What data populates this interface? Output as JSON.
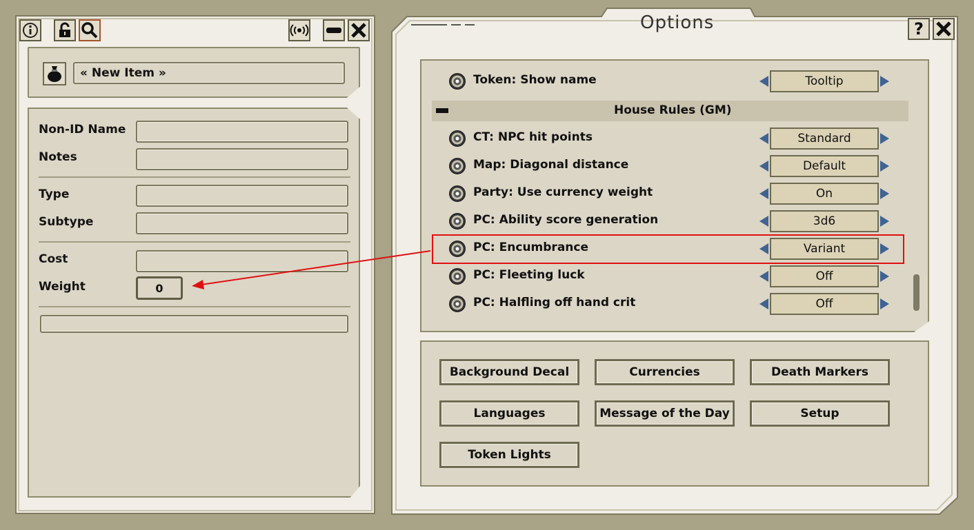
{
  "item_window": {
    "title_field": "« New Item »",
    "toolbar": [
      "info-icon",
      "lock-icon",
      "search-icon",
      "broadcast-icon",
      "minimize-icon",
      "close-icon"
    ],
    "labels": {
      "nonid_name": "Non-ID Name",
      "notes": "Notes",
      "type": "Type",
      "subtype": "Subtype",
      "cost": "Cost",
      "weight": "Weight"
    },
    "weight_value": "0"
  },
  "options_window": {
    "title": "Options",
    "help_label": "?",
    "rows": [
      {
        "label": "Token: Show name",
        "value": "Tooltip"
      },
      {
        "label": "CT: NPC hit points",
        "value": "Standard"
      },
      {
        "label": "Map: Diagonal distance",
        "value": "Default"
      },
      {
        "label": "Party: Use currency weight",
        "value": "On"
      },
      {
        "label": "PC: Ability score generation",
        "value": "3d6"
      },
      {
        "label": "PC: Encumbrance",
        "value": "Variant"
      },
      {
        "label": "PC: Fleeting luck",
        "value": "Off"
      },
      {
        "label": "PC: Halfling off hand crit",
        "value": "Off"
      }
    ],
    "section_header": "House Rules (GM)",
    "buttons": {
      "background_decal": "Background Decal",
      "currencies": "Currencies",
      "death_markers": "Death Markers",
      "languages": "Languages",
      "message_of_the_day": "Message of the Day",
      "setup": "Setup",
      "token_lights": "Token Lights"
    }
  },
  "colors": {
    "background": "#a9a387",
    "panel": "#dcd6c6",
    "highlight_annotation": "#e01010",
    "cycler_arrow": "#3f6392"
  }
}
